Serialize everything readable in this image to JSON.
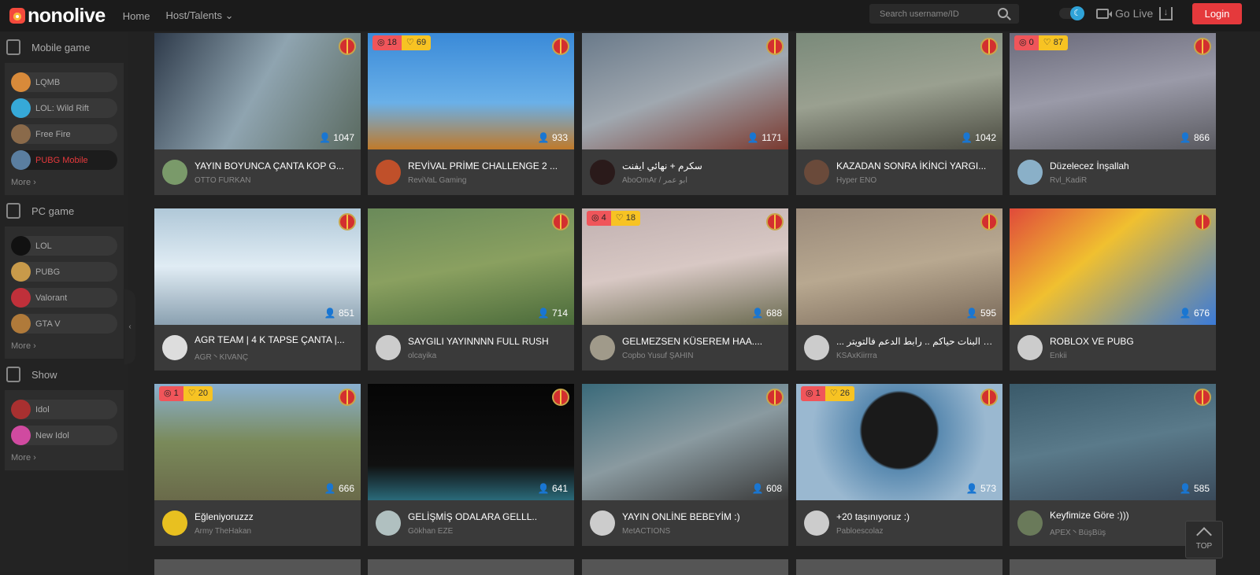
{
  "header": {
    "logo": "nonolive",
    "nav": [
      "Home",
      "Host/Talents ⌄"
    ],
    "search_placeholder": "Search username/ID",
    "golive": "Go Live",
    "login": "Login"
  },
  "sidebar": {
    "sections": [
      {
        "title": "Mobile game",
        "items": [
          {
            "label": "LQMB",
            "color": "#d88a3a"
          },
          {
            "label": "LOL: Wild Rift",
            "color": "#36a9d8"
          },
          {
            "label": "Free Fire",
            "color": "#8a6a4a"
          },
          {
            "label": "PUBG Mobile",
            "color": "#5a7ea0",
            "active": true
          }
        ],
        "more": "More ›"
      },
      {
        "title": "PC game",
        "items": [
          {
            "label": "LOL",
            "color": "#111"
          },
          {
            "label": "PUBG",
            "color": "#c89a4a"
          },
          {
            "label": "Valorant",
            "color": "#c0303a"
          },
          {
            "label": "GTA V",
            "color": "#b07a3a"
          }
        ],
        "more": "More ›"
      },
      {
        "title": "Show",
        "items": [
          {
            "label": "Idol",
            "color": "#a83030"
          },
          {
            "label": "New Idol",
            "color": "#d04aa0"
          }
        ],
        "more": "More ›"
      }
    ]
  },
  "accent": "#e5393c",
  "cards": [
    {
      "title": "YAYIN BOYUNCA ÇANTA KOP G...",
      "host": "OTTO FURKAN",
      "viewers": "1047",
      "thumb": "linear-gradient(120deg,#2e3a4a,#8fa4b0 50%,#5a6a60)",
      "avatar": "#7a9a6a"
    },
    {
      "title": "REVİVAL PRİME CHALLENGE 2 ...",
      "host": "ReviVaL Gaming",
      "viewers": "933",
      "badge": [
        "18",
        "69"
      ],
      "thumb": "linear-gradient(180deg,#3a8ad8,#6ab0e8 60%,#c07a2a)",
      "avatar": "#c0502a"
    },
    {
      "title": "سكرم + نهائي ايفنت",
      "host": "AboOmAr / ابو عمر",
      "viewers": "1171",
      "thumb": "linear-gradient(160deg,#6a7a8a,#a0a8b0 50%,#7a3a30)",
      "avatar": "#2a1a1a"
    },
    {
      "title": "KAZADAN SONRA İKİNCİ YARGI...",
      "host": "Hyper ENO",
      "viewers": "1042",
      "thumb": "linear-gradient(170deg,#7a8a7a,#9aa090 50%,#4a4a40)",
      "avatar": "#6a4a3a"
    },
    {
      "title": "Düzelecez İnşallah",
      "host": "Rvl_KadiR",
      "viewers": "866",
      "badge": [
        "0",
        "87"
      ],
      "thumb": "linear-gradient(170deg,#6a6a7a,#9a9aa8 50%,#5a5a60)",
      "avatar": "#8ab0c8"
    },
    {
      "title": "AGR TEAM | 4 K TAPSE ÇANTA |...",
      "host": "AGR丶KIVANÇ",
      "viewers": "851",
      "thumb": "linear-gradient(180deg,#b0c8d8,#e0ecf4 50%,#8aa0b0)",
      "avatar": "#ddd"
    },
    {
      "title": "SAYGILI YAYINNNN FULL RUSH",
      "host": "olcayika",
      "viewers": "714",
      "thumb": "linear-gradient(170deg,#6a8a5a,#8aa060 50%,#4a6a3a)",
      "avatar": "#ccc"
    },
    {
      "title": "GELMEZSEN KÜSEREM HAA....",
      "host": "Copbo Yusuf ŞAHIN",
      "viewers": "688",
      "badge": [
        "4",
        "18"
      ],
      "thumb": "linear-gradient(170deg,#c0b0b0,#d8c8c4 50%,#6a6a50)",
      "avatar": "#a09a8a"
    },
    {
      "title": "... العيال ولا البنات حياكم .. رابط الدعم فالتويتر",
      "host": "KSAxKiirrra",
      "viewers": "595",
      "thumb": "linear-gradient(170deg,#9a8a7a,#b8a890 50%,#7a6a5a)",
      "avatar": "#ccc"
    },
    {
      "title": "ROBLOX VE PUBG",
      "host": "Enkii",
      "viewers": "676",
      "thumb": "linear-gradient(140deg,#e04a3a,#f0c030 40%,#3a7ad8)",
      "avatar": "#ccc"
    },
    {
      "title": "Eğleniyoruzzz",
      "host": "Army TheHakan",
      "viewers": "666",
      "badge": [
        "1",
        "20"
      ],
      "thumb": "linear-gradient(180deg,#8ab0d0,#7a8a5a 50%,#6a6a4a)",
      "avatar": "#e8c020"
    },
    {
      "title": "GELİŞMİŞ ODALARA GELLL..",
      "host": "Gökhan EZE",
      "viewers": "641",
      "thumb": "linear-gradient(180deg,#050505,#101010 70%,#2a6a7a)",
      "avatar": "#b0c0c0"
    },
    {
      "title": "YAYIN ONLİNE BEBEYİM :)",
      "host": "MetACTIONS",
      "viewers": "608",
      "thumb": "linear-gradient(160deg,#3a6a7a,#8a9aa0 50%,#3a3a3a)",
      "avatar": "#ccc"
    },
    {
      "title": "+20 taşınıyoruz :)",
      "host": "Pabloescolaz",
      "viewers": "573",
      "badge": [
        "1",
        "26"
      ],
      "thumb": "radial-gradient(circle at 50% 40%,#1a1a1a 30%,#5a8ab0 32%,#9ab8d0 70%)",
      "avatar": "#ccc"
    },
    {
      "title": "Keyfimize Göre :)))",
      "host": "APEX丶BüşBüş",
      "viewers": "585",
      "thumb": "linear-gradient(170deg,#3a5a6a,#5a7a8a 50%,#3a4a5a)",
      "avatar": "#6a7a5a"
    }
  ],
  "top_button": "TOP"
}
